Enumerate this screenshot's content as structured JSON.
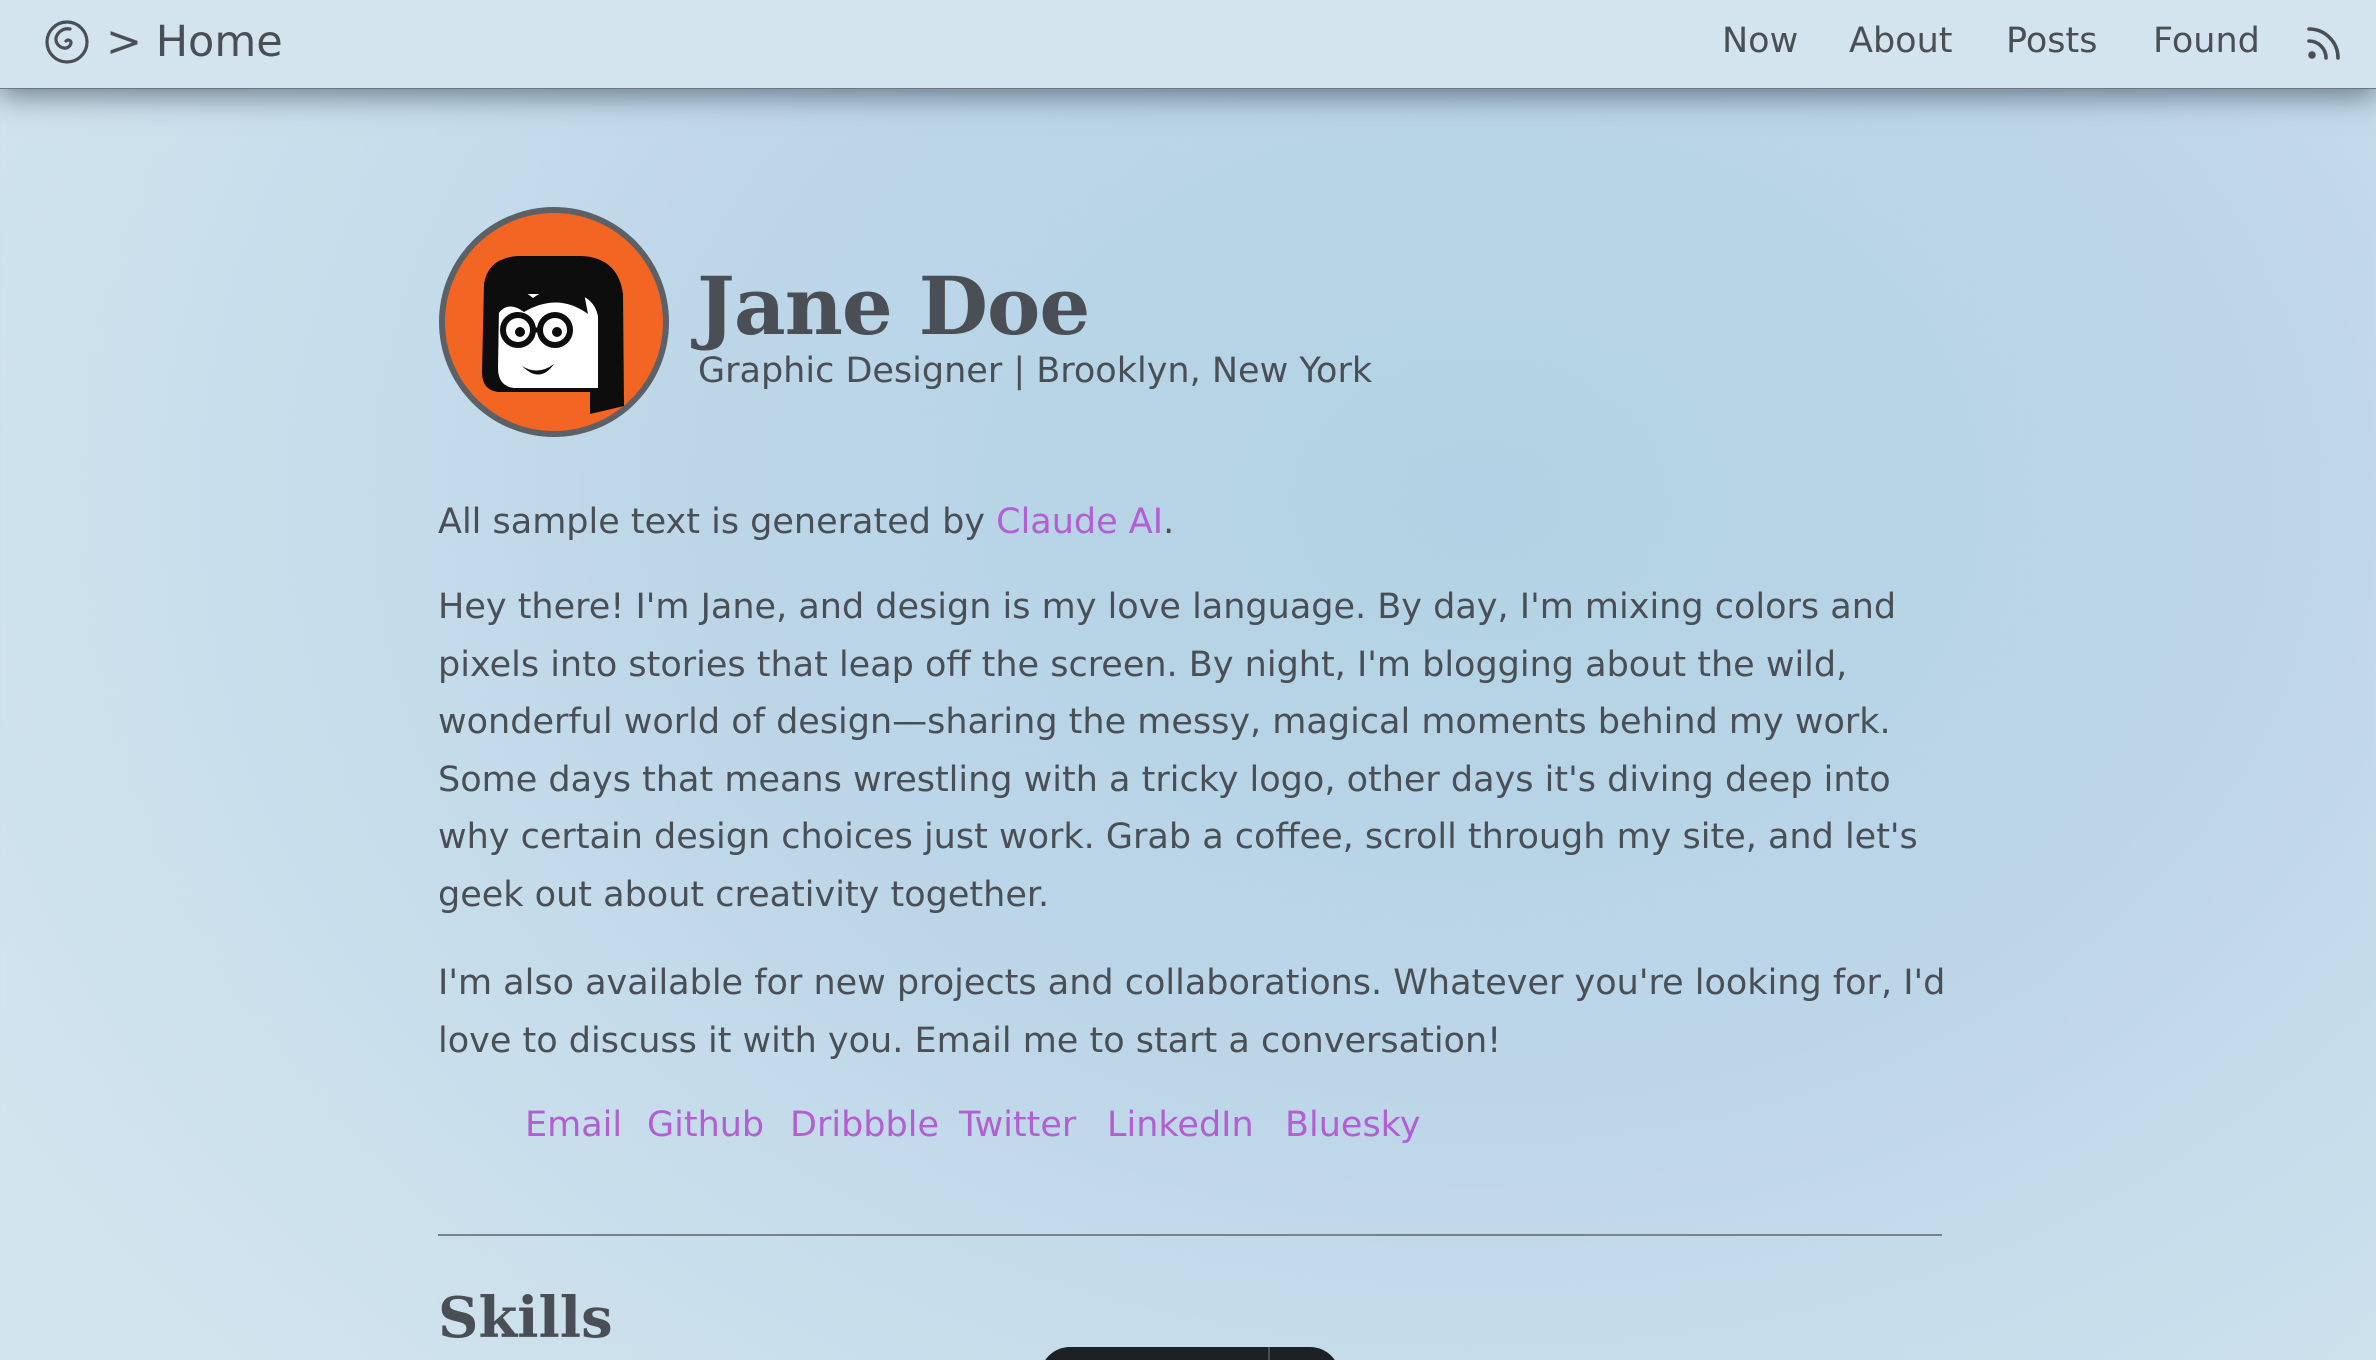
{
  "header": {
    "logo_icon": "spiral-icon",
    "home_label": "> Home",
    "nav": [
      "Now",
      "About",
      "Posts",
      "Found"
    ],
    "rss_icon": "rss-icon"
  },
  "profile": {
    "avatar_icon": "cartoon-avatar",
    "name": "Jane Doe",
    "tagline": "Graphic Designer | Brooklyn, New York"
  },
  "intro": {
    "prefix": "All sample text is generated by ",
    "link_text": "Claude AI",
    "suffix": "."
  },
  "bio": [
    "Hey there! I'm Jane, and design is my love language. By day, I'm mixing colors and pixels into stories that leap off the screen. By night, I'm blogging about the wild, wonderful world of design—sharing the messy, magical moments behind my work. Some days that means wrestling with a tricky logo, other days it's diving deep into why certain design choices just work. Grab a coffee, scroll through my site, and let's geek out about creativity together.",
    "I'm also available for new projects and collaborations. Whatever you're looking for, I'd love to discuss it with you. Email me to start a conversation!"
  ],
  "social_links": [
    "Email",
    "Github",
    "Dribbble",
    "Twitter",
    "LinkedIn",
    "Bluesky"
  ],
  "sections": {
    "skills_heading": "Skills"
  },
  "colors": {
    "accent_link": "#b35ed3",
    "text": "#4a4f55",
    "avatar_bg": "#f26522",
    "header_bg": "#d3e4ef"
  }
}
